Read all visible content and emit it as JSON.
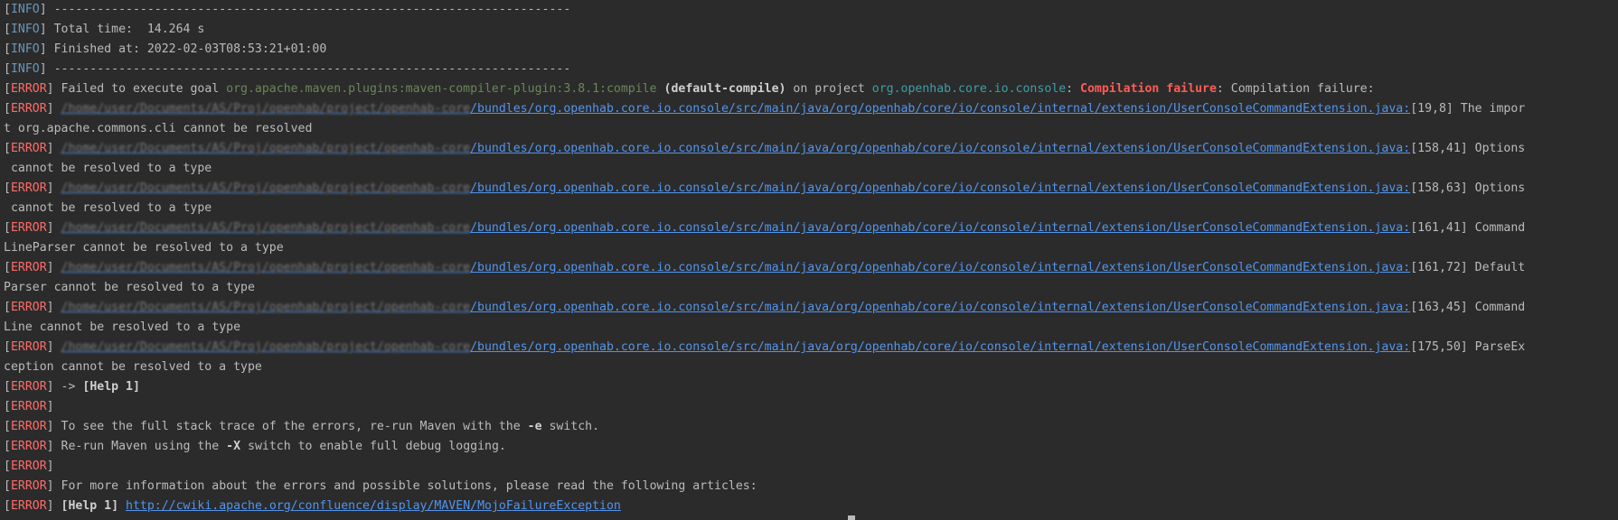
{
  "console": {
    "tags": {
      "info": "INFO",
      "error": "ERROR"
    },
    "separator": "------------------------------------------------------------------------",
    "total_time": "Total time:  14.264 s",
    "finished_at": "Finished at: 2022-02-03T08:53:21+01:00",
    "failure": {
      "prefix": "Failed to execute goal ",
      "plugin": "org.apache.maven.plugins:maven-compiler-plugin:3.8.1:compile",
      "goal": "(default-compile)",
      "on_project": " on project ",
      "project": "org.openhab.core.io.console",
      "colon": ": ",
      "compilation_failure": "Compilation failure",
      "suffix": ": Compilation failure:"
    },
    "file_path_visible": "/bundles/org.openhab.core.io.console/src/main/java/org/openhab/core/io/console/internal/extension/UserConsoleCommandExtension.java:",
    "errors": [
      {
        "redacted": "/home/user/Documents/AS/Proj/openhab/project/openhab-core",
        "location": "[19,8] The impor",
        "continuation": "t org.apache.commons.cli cannot be resolved"
      },
      {
        "redacted": "/home/user/Documents/AS/Proj/openhab/project/openhab-core",
        "location": "[158,41] Options",
        "continuation": " cannot be resolved to a type"
      },
      {
        "redacted": "/home/user/Documents/AS/Proj/openhab/project/openhab-core",
        "location": "[158,63] Options",
        "continuation": " cannot be resolved to a type"
      },
      {
        "redacted": "/home/user/Documents/AS/Proj/openhab/project/openhab-core",
        "location": "[161,41] Command",
        "continuation": "LineParser cannot be resolved to a type"
      },
      {
        "redacted": "/home/user/Documents/AS/Proj/openhab/project/openhab-core",
        "location": "[161,72] Default",
        "continuation": "Parser cannot be resolved to a type"
      },
      {
        "redacted": "/home/user/Documents/AS/Proj/openhab/project/openhab-core",
        "location": "[163,45] Command",
        "continuation": "Line cannot be resolved to a type"
      },
      {
        "redacted": "/home/user/Documents/AS/Proj/openhab/project/openhab-core",
        "location": "[175,50] ParseEx",
        "continuation": "ception cannot be resolved to a type"
      }
    ],
    "help_ref": "-> ",
    "help_label": "[Help 1]",
    "stack_trace_a": "To see the full stack trace of the errors, re-run Maven with the ",
    "stack_trace_switch": "-e",
    "stack_trace_b": " switch.",
    "debug_a": "Re-run Maven using the ",
    "debug_switch": "-X",
    "debug_b": " switch to enable full debug logging.",
    "more_info": "For more information about the errors and possible solutions, please read the following articles:",
    "help_url": "http://cwiki.apache.org/confluence/display/MAVEN/MojoFailureException"
  },
  "colors": {
    "background": "#2b2b2b",
    "text": "#bbbbbb",
    "info": "#6897bb",
    "error": "#ff6b68",
    "link": "#5394ec",
    "plugin": "#6a8759",
    "project": "#3f9ea7"
  }
}
